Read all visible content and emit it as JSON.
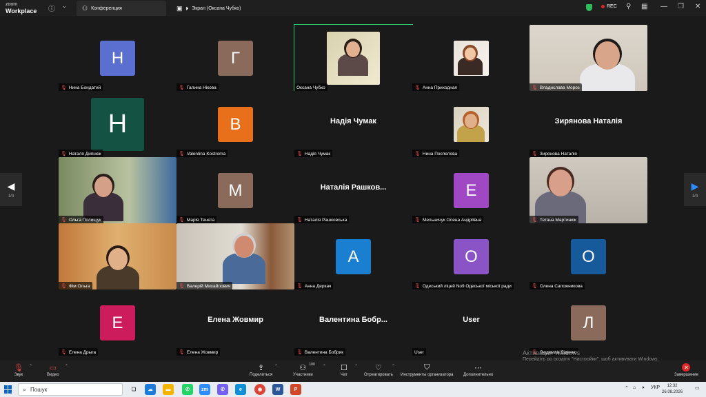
{
  "app": {
    "logo_line1": "zoom",
    "logo_line2": "Workplace"
  },
  "tabs": [
    {
      "label": "Конференция",
      "icon": "meeting-icon"
    },
    {
      "label": "Экран (Оксана Чубко)",
      "icon": "screen-share-icon"
    }
  ],
  "status": {
    "rec_label": "REC",
    "encryption_icon": "shield-icon"
  },
  "pager": {
    "left_label": "1/4",
    "right_label": "1/4"
  },
  "participants": [
    {
      "name": "Нина Бондатий",
      "type": "letter",
      "letter": "Н",
      "color": "#5a6fcf",
      "muted": true
    },
    {
      "name": "Галина Нікова",
      "type": "letter",
      "letter": "Г",
      "color": "#8a6a5b",
      "muted": true
    },
    {
      "name": "Оксана Чубко",
      "type": "photo",
      "muted": false,
      "active_speaker": true
    },
    {
      "name": "Анна Приходная",
      "type": "photo",
      "muted": true
    },
    {
      "name": "Владислава Мороз",
      "type": "video",
      "muted": true
    },
    {
      "name": "Наталя Дипнюк",
      "type": "letter",
      "letter": "Н",
      "color": "#145244",
      "muted": true,
      "big": true
    },
    {
      "name": "Valentina Kostroma",
      "type": "letter",
      "letter": "В",
      "color": "#e8701a",
      "muted": true
    },
    {
      "name": "Надія Чумак",
      "type": "text",
      "display": "Надія Чумак",
      "muted": true
    },
    {
      "name": "Нина Поспелова",
      "type": "photo",
      "muted": true
    },
    {
      "name": "Зирянова Наталія",
      "type": "text",
      "display": "Зирянова Наталія",
      "muted": true
    },
    {
      "name": "Ольга Полищук",
      "type": "video",
      "muted": true
    },
    {
      "name": "Марія Тенета",
      "type": "letter",
      "letter": "М",
      "color": "#8a6a5b",
      "muted": true
    },
    {
      "name": "Наталія Рашковська",
      "type": "text",
      "display": "Наталія Рашков...",
      "muted": true
    },
    {
      "name": "Мельничук Олена Андріївна",
      "type": "letter",
      "letter": "Е",
      "color": "#a048c4",
      "muted": true
    },
    {
      "name": "Тетяна Мартинюк",
      "type": "video",
      "muted": true
    },
    {
      "name": "Фім Ольга",
      "type": "video",
      "muted": true
    },
    {
      "name": "Валерій Михайлович",
      "type": "video",
      "muted": true
    },
    {
      "name": "Анна Деркач",
      "type": "letter",
      "letter": "А",
      "color": "#1b7fd1",
      "muted": true
    },
    {
      "name": "Одеський ліцей No9 Одеської міської ради",
      "type": "letter",
      "letter": "О",
      "color": "#8a54c6",
      "muted": true
    },
    {
      "name": "Олена Сапожникова",
      "type": "letter",
      "letter": "О",
      "color": "#165a9c",
      "muted": true
    },
    {
      "name": "Елена Дрыга",
      "type": "letter",
      "letter": "Е",
      "color": "#cc1c5c",
      "muted": true
    },
    {
      "name": "Елена Жовмир",
      "type": "text",
      "display": "Елена Жовмир",
      "muted": true
    },
    {
      "name": "Валентина Бобрик",
      "type": "text",
      "display": "Валентина  Бобр...",
      "muted": true
    },
    {
      "name": "User",
      "type": "text",
      "display": "User",
      "muted": false
    },
    {
      "name": "Людмила Діденко",
      "type": "letter",
      "letter": "Л",
      "color": "#8a6a5b",
      "muted": true
    }
  ],
  "watermark": {
    "line1": "Активация Windows",
    "line2": "Перейдіть до розділу \"Настройки\", щоб активувати Windows."
  },
  "toolbar": {
    "audio": "Звук",
    "video": "Видео",
    "share": "Поделиться",
    "participants": "Участники",
    "participants_count": "100",
    "chat": "Чат",
    "react": "Отреагировать",
    "host_tools": "Инструменты организатора",
    "more": "Дополнительно",
    "end": "Завершение"
  },
  "taskbar": {
    "search_placeholder": "Пошук",
    "language": "УКР",
    "time": "12:32",
    "date": "26.08.2026"
  }
}
